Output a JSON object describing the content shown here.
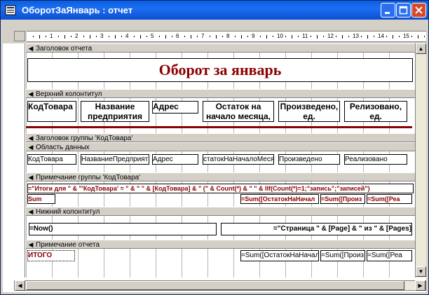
{
  "window": {
    "title": "ОборотЗаЯнварь : отчет"
  },
  "sections": {
    "report_header": "Заголовок отчета",
    "page_header": "Верхний колонтитул",
    "group_header": "Заголовок группы 'КодТовара'",
    "detail": "Область данных",
    "group_footer": "Примечание группы 'КодТовара'",
    "page_footer": "Нижний колонтитул",
    "report_footer": "Примечание отчета"
  },
  "report_title": "Оборот за январь",
  "page_header_labels": [
    "КодТовара",
    "Название предприятия",
    "Адрес",
    "Остаток на начало месяца,",
    "Произведено, ед.",
    "Релизовано, ед."
  ],
  "detail_fields": [
    "КодТовара",
    "НазваниеПредприят",
    "Адрес",
    "статокНаНачалоМеся",
    "Произведено",
    "Реализовано"
  ],
  "group_footer": {
    "expr1": "=\"Итоги для \" & \"'КодТовара' = \" & \" \" & [КодТовара] & \" (\" & Count(*) & \" \" & IIf(Count(*)=1;\"запись\";\"записей\")",
    "sum_label": "Sum",
    "sums": [
      "=Sum([ОстатокНаНачал",
      "=Sum([Произ",
      "=Sum([Реа"
    ]
  },
  "page_footer": {
    "now": "=Now()",
    "page": "=\"Страница \" & [Page] & \" из \" & [Pages]"
  },
  "report_footer": {
    "total_label": "ИТОГО",
    "sums": [
      "=Sum([ОстатокНаНачал",
      "=Sum([Произ",
      "=Sum([Реа"
    ]
  },
  "ruler": {
    "numbers": [
      "1",
      "2",
      "3",
      "4",
      "5",
      "6",
      "7",
      "8",
      "9",
      "10",
      "11",
      "12",
      "13",
      "14",
      "15",
      "16"
    ]
  },
  "colors": {
    "title": "#8b0000",
    "expr": "#8b0000",
    "titlebar": "#0a5fe0"
  }
}
